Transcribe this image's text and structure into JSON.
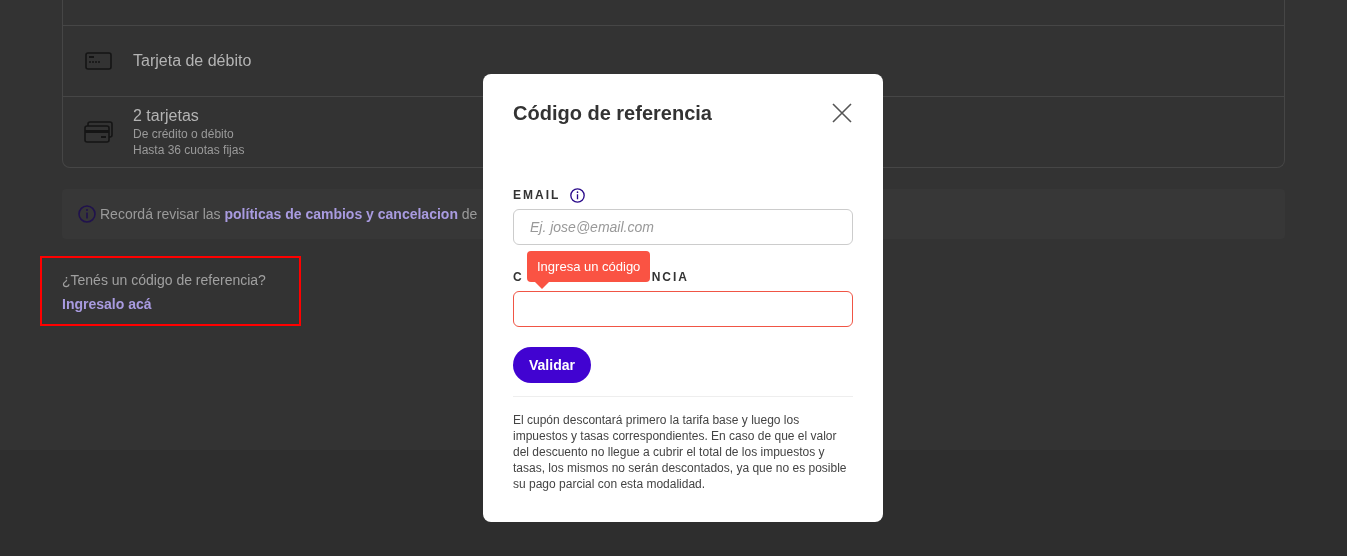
{
  "payment_methods": [
    {
      "kind": "debit",
      "title": "Tarjeta de débito"
    },
    {
      "kind": "two_cards",
      "title": "2 tarjetas",
      "subtitle_lines": [
        "De crédito o débito",
        "Hasta 36 cuotas fijas"
      ]
    }
  ],
  "notice": {
    "text_before": "Recordá revisar las",
    "link": "políticas de cambios y cancelacion",
    "text_after": "de"
  },
  "referral": {
    "question": "¿Tenés un código de referencia?",
    "link": "Ingresalo acá",
    "highlighted": true
  },
  "modal": {
    "title": "Código de referencia",
    "email": {
      "label": "EMAIL",
      "placeholder": "Ej. jose@email.com"
    },
    "code": {
      "label_start": "C",
      "label_end": "NCIA",
      "error": true,
      "tooltip": "Ingresa un código"
    },
    "button": "Validar",
    "note": "El cupón descontará primero la tarifa base y luego los impuestos y tasas correspondientes. En caso de que el valor del descuento no llegue a cubrir el total de los impuestos y tasas, los mismos no serán descontados, ya que no es posible su pago parcial con esta modalidad."
  }
}
